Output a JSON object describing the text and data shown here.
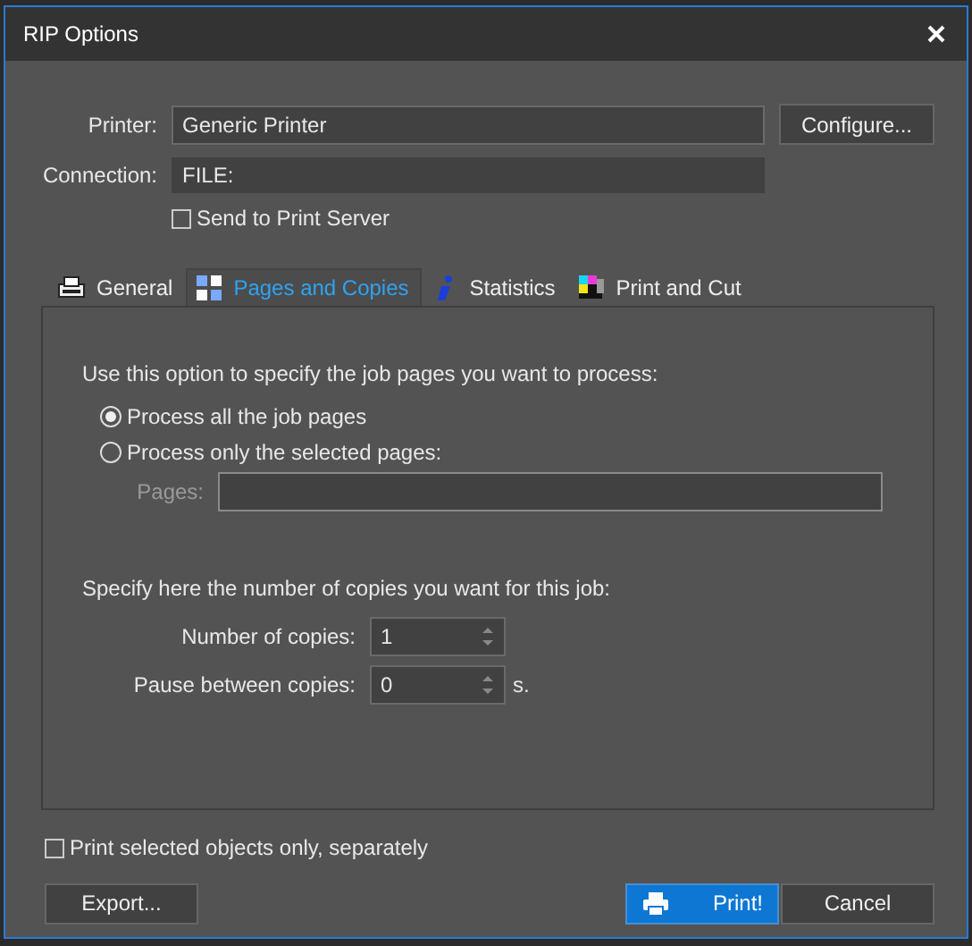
{
  "window": {
    "title": "RIP Options"
  },
  "printer": {
    "label": "Printer:",
    "value": "Generic Printer"
  },
  "configure_button": "Configure...",
  "connection": {
    "label": "Connection:",
    "value": "FILE:"
  },
  "send_to_print_server": {
    "label": "Send to Print Server",
    "checked": false
  },
  "tabs": [
    {
      "label": "General",
      "selected": false
    },
    {
      "label": "Pages and Copies",
      "selected": true
    },
    {
      "label": "Statistics",
      "selected": false
    },
    {
      "label": "Print and Cut",
      "selected": false
    }
  ],
  "pages_intro": "Use this option to specify the job pages you want to process:",
  "page_options": [
    {
      "label": "Process all the job pages",
      "selected": true
    },
    {
      "label": "Process only the selected pages:",
      "selected": false
    }
  ],
  "pages_field": {
    "label": "Pages:",
    "disabled": true
  },
  "copies_intro": "Specify here the number of copies you want for this job:",
  "spinners": [
    {
      "label": "Number of copies:",
      "value": "1"
    },
    {
      "label": "Pause between copies:",
      "value": "0",
      "unit": "s."
    }
  ],
  "print_selected_only": {
    "label": "Print selected objects only, separately",
    "checked": false
  },
  "buttons": [
    {
      "label": "Export...",
      "kind": "plain"
    },
    {
      "label": "Print!",
      "kind": "default"
    },
    {
      "label": "Cancel",
      "kind": "plain"
    }
  ]
}
